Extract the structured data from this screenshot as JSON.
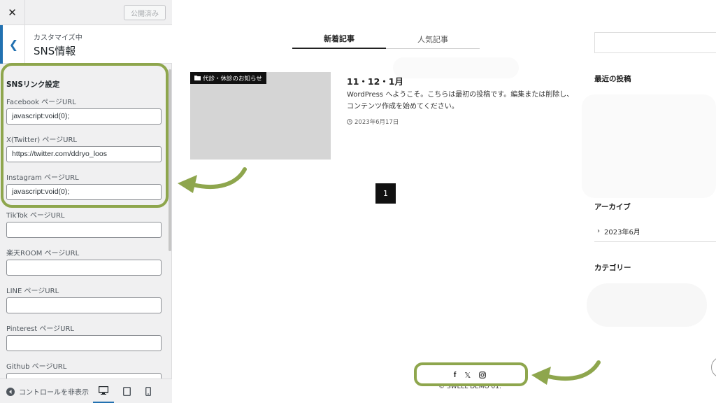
{
  "panel": {
    "close_icon": "close-icon",
    "publish_label": "公開済み",
    "breadcrumb": "カスタマイズ中",
    "section_title": "SNS情報",
    "group_title": "SNSリンク設定",
    "fields": [
      {
        "label": "Facebook ページURL",
        "value": "javascript:void(0);"
      },
      {
        "label": "X(Twitter) ページURL",
        "value": "https://twitter.com/ddryo_loos"
      },
      {
        "label": "Instagram ページURL",
        "value": "javascript:void(0);"
      },
      {
        "label": "TikTok ページURL",
        "value": ""
      },
      {
        "label": "楽天ROOM ページURL",
        "value": ""
      },
      {
        "label": "LINE ページURL",
        "value": ""
      },
      {
        "label": "Pinterest ページURL",
        "value": ""
      },
      {
        "label": "Github ページURL",
        "value": ""
      }
    ],
    "footer": {
      "hide_controls_label": "コントロールを非表示",
      "devices": [
        "desktop-icon",
        "tablet-icon",
        "mobile-icon"
      ],
      "active_device": "desktop"
    }
  },
  "preview": {
    "tabs": [
      {
        "label": "新着記事",
        "active": true
      },
      {
        "label": "人気記事",
        "active": false
      }
    ],
    "post": {
      "category": "代診・休診のお知らせ",
      "title": "11・12・1月",
      "excerpt": "WordPress へようこそ。こちらは最初の投稿です。編集または削除し、コンテンツ作成を始めてください。",
      "date": "2023年6月17日"
    },
    "pagination": {
      "current": "1"
    },
    "sidebar": {
      "recent_posts_title": "最近の投稿",
      "archive_title": "アーカイブ",
      "archive_item": "2023年6月",
      "category_title": "カテゴリー"
    },
    "footer": {
      "sns_icons": [
        "facebook-icon",
        "x-twitter-icon",
        "instagram-icon"
      ],
      "copyright": "© SWELL DEMO 01."
    }
  },
  "annotation": {
    "color": "#8ea64d"
  }
}
